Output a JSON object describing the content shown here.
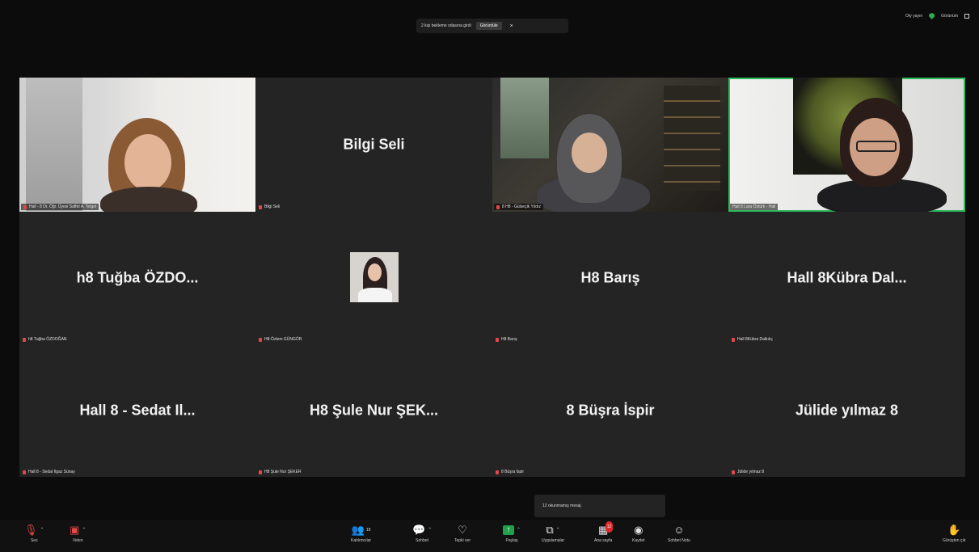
{
  "notification": {
    "text": "2 kişi bekleme odasına girdi",
    "button": "Görüntüle",
    "close": "×"
  },
  "topbar": {
    "record": "Oty yayın",
    "view": "Görünüm"
  },
  "tiles": [
    {
      "big": "",
      "label": "Hall - 8 Dr. Öğr. Üyesi Saffet A. Tetgel"
    },
    {
      "big": "Bilgi Seli",
      "label": "Bilgi Seli"
    },
    {
      "big": "",
      "label": "8 H8 - Gülseçik Yıldız"
    },
    {
      "big": "",
      "label": "Hall 8 Lara Öztürk - Hall"
    },
    {
      "big": "h8 Tuğba ÖZDO...",
      "label": "h8 Tuğba ÖZDOĞAN"
    },
    {
      "big": "",
      "label": "H8-Özlem GÜNGÖR"
    },
    {
      "big": "H8 Barış",
      "label": "H8 Barış"
    },
    {
      "big": "Hall 8Kübra Dal...",
      "label": "Hall 8Kübra Dalkılıç"
    },
    {
      "big": "Hall 8 - Sedat Il...",
      "label": "Hall 8 - Sedat Ilgaz Sünay"
    },
    {
      "big": "H8 Şule Nur ŞEK...",
      "label": "H8 Şule Nur ŞEKER"
    },
    {
      "big": "8 Büşra İspir",
      "label": "8 Büşra İspir"
    },
    {
      "big": "Jülide yılmaz 8",
      "label": "Jülide yılmaz 8"
    }
  ],
  "popup": {
    "text": "12 okunmamış mesaj"
  },
  "toolbar": {
    "audio": "Ses",
    "video": "Video",
    "participants": "Katılımcılar",
    "participants_count": "19",
    "chat": "Sohbet",
    "react": "Tepki ver",
    "share": "Paylaş",
    "apps": "Uygulamalar",
    "more": "Ana sayfa",
    "more_badge": "12",
    "record": "Kaydet",
    "notes": "Sohbet Notu",
    "end": "Görüşten çık"
  },
  "colors": {
    "active_speaker": "#2dba5a",
    "share": "#22a04c",
    "muted": "#e24a4a"
  }
}
